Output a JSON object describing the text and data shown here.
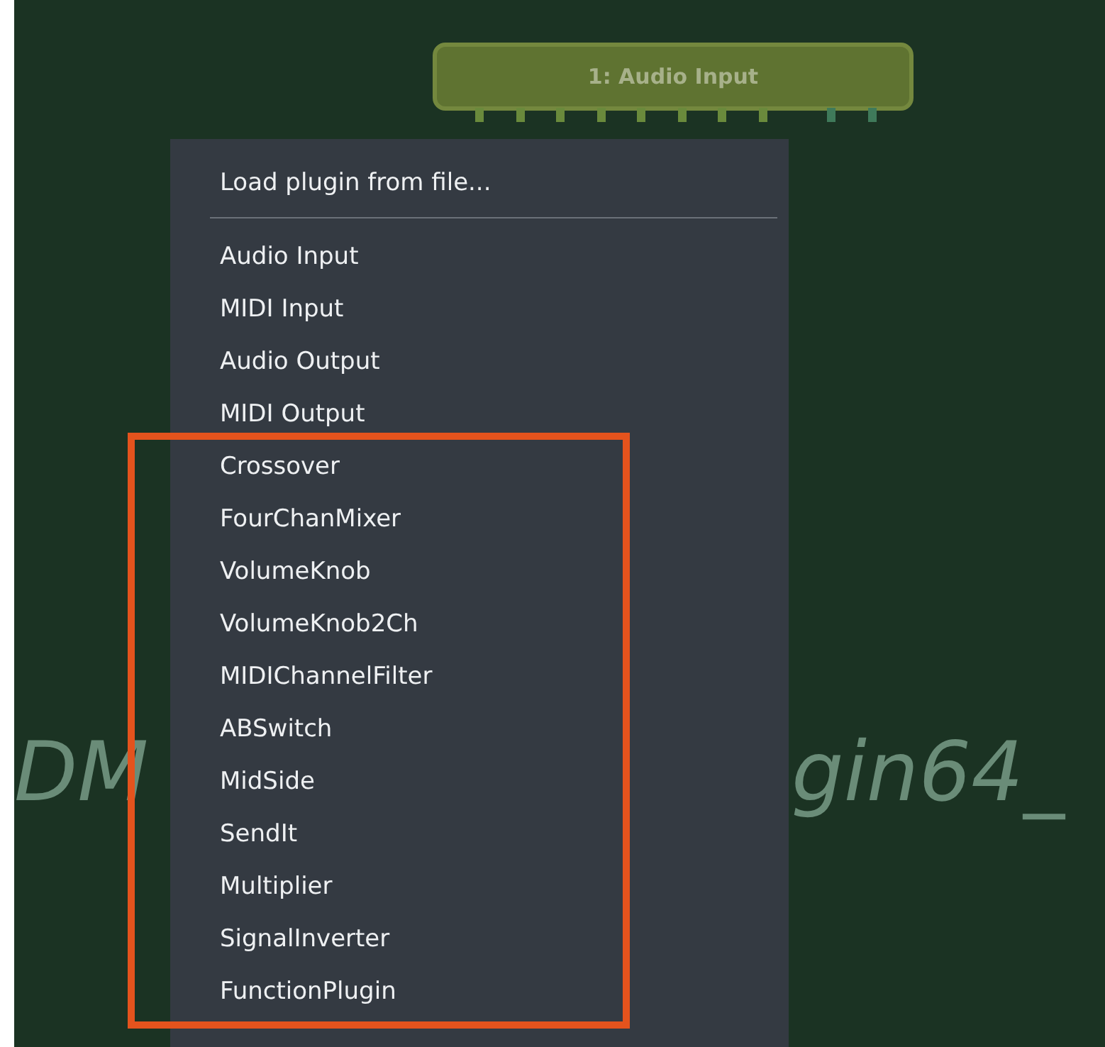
{
  "node": {
    "title": "1: Audio Input",
    "ports": [
      {
        "kind": "audio"
      },
      {
        "kind": "audio"
      },
      {
        "kind": "audio"
      },
      {
        "kind": "audio"
      },
      {
        "kind": "audio"
      },
      {
        "kind": "audio"
      },
      {
        "kind": "audio"
      },
      {
        "kind": "audio"
      },
      {
        "kind": "midi"
      },
      {
        "kind": "midi"
      }
    ]
  },
  "background_text": {
    "left": "DM",
    "right": "gin64_"
  },
  "menu": {
    "header_item": "Load plugin from file...",
    "items": [
      "Audio Input",
      "MIDI Input",
      "Audio Output",
      "MIDI Output"
    ],
    "highlighted_items": [
      "Crossover",
      "FourChanMixer",
      "VolumeKnob",
      "VolumeKnob2Ch",
      "MIDIChannelFilter",
      "ABSwitch",
      "MidSide",
      "SendIt",
      "Multiplier",
      "SignalInverter",
      "FunctionPlugin"
    ]
  }
}
